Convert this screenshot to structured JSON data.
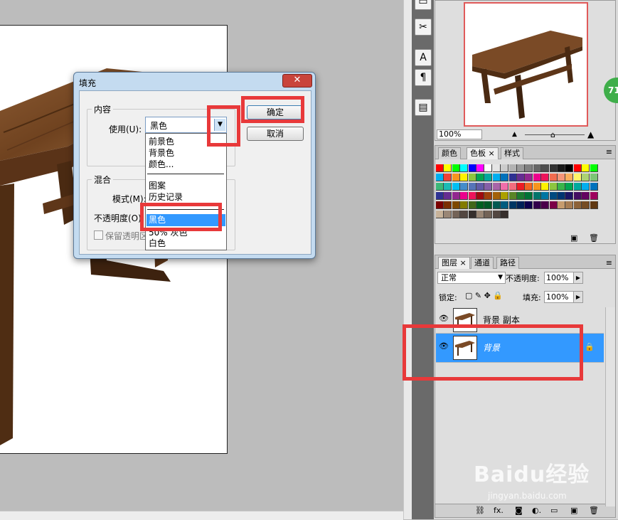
{
  "dialog": {
    "title": "填充",
    "close_label": "✕",
    "content_group": "内容",
    "use_label": "使用(U):",
    "use_value": "黑色",
    "ok_label": "确定",
    "cancel_label": "取消",
    "blend_group": "混合",
    "mode_label": "模式(M):",
    "opacity_label": "不透明度(O):",
    "preserve_label": "保留透明区",
    "dropdown_options": [
      "前景色",
      "背景色",
      "颜色...",
      "图案",
      "历史记录",
      "黑色",
      "50% 灰色",
      "白色"
    ],
    "selected_option": "黑色"
  },
  "navigator": {
    "zoom": "100%"
  },
  "swatches_panel": {
    "tabs": [
      "颜色",
      "色板 ×",
      "样式"
    ]
  },
  "layers_panel": {
    "tabs": [
      "图层 ×",
      "通道",
      "路径"
    ],
    "blend_mode": "正常",
    "opacity_label": "不透明度:",
    "opacity_value": "100%",
    "lock_label": "锁定:",
    "fill_label": "填充:",
    "fill_value": "100%",
    "layers": [
      {
        "name": "背景 副本",
        "selected": false
      },
      {
        "name": "背景",
        "selected": true
      }
    ]
  },
  "badge": "71",
  "watermark": {
    "brand": "Baidu经验",
    "url": "jingyan.baidu.com"
  },
  "colors": {
    "highlight_red": "#e8393a",
    "selection_blue": "#3399ff",
    "wood": "#7a4a26"
  }
}
